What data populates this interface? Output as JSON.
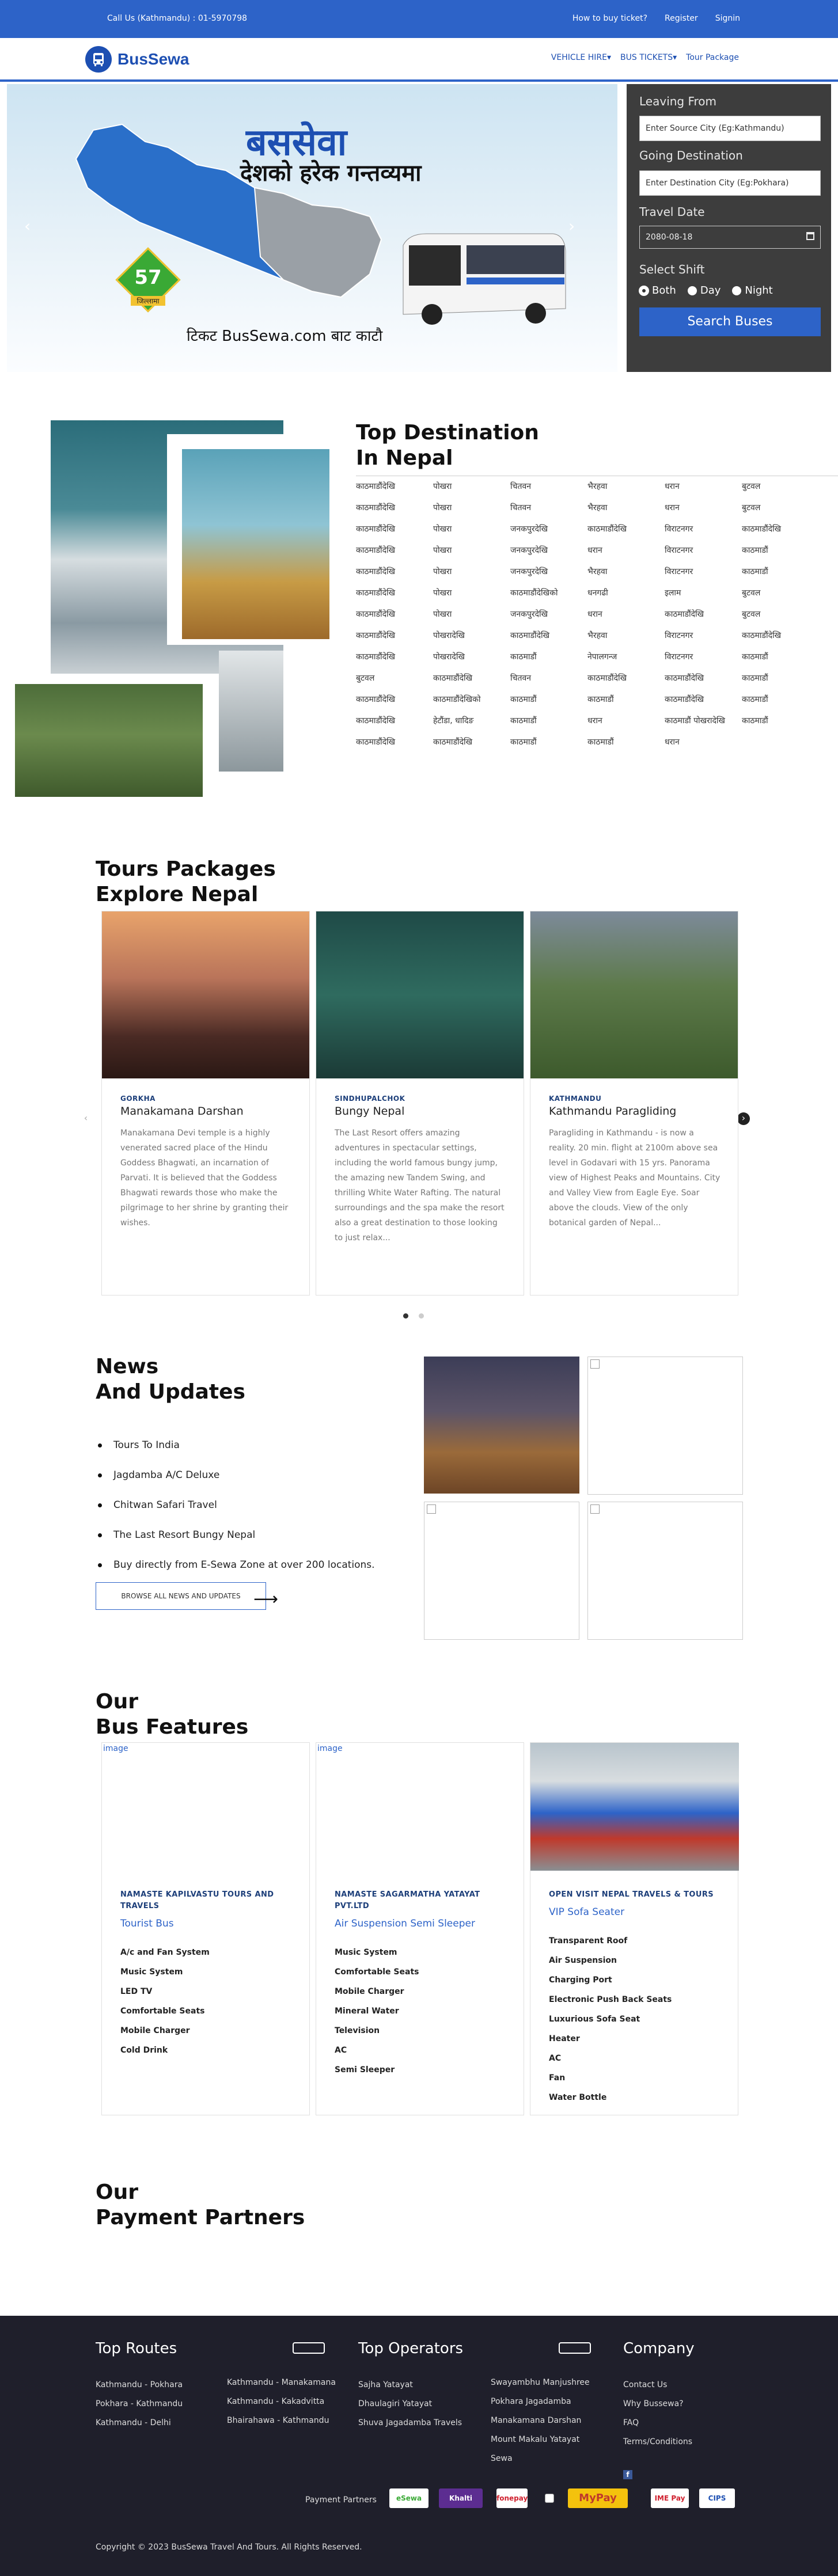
{
  "topbar": {
    "call": "Call Us (Kathmandu) : 01-5970798",
    "links": [
      "How to buy ticket?",
      "Register",
      "Signin"
    ]
  },
  "nav": {
    "logo": "BusSewa",
    "items": [
      "VEHICLE HIRE▾",
      "BUS TICKETS▾",
      "Tour Package"
    ]
  },
  "hero": {
    "title": "बससेवा",
    "subtitle": "देशको हरेक गन्तव्यमा",
    "tagline": "टिकट BusSewa.com बाट काटौ",
    "badge_number": "57",
    "badge_label": "जिल्लामा"
  },
  "search": {
    "from_label": "Leaving From",
    "from_placeholder": "Enter Source City (Eg:Kathmandu)",
    "to_label": "Going Destination",
    "to_placeholder": "Enter Destination City (Eg:Pokhara)",
    "date_label": "Travel Date",
    "date_value": "2080-08-18",
    "shift_label": "Select Shift",
    "shifts": [
      "Both",
      "Day",
      "Night"
    ],
    "button": "Search Buses"
  },
  "destinations": {
    "title1": "Top Destination",
    "title2": "In Nepal",
    "rows": [
      [
        "काठमाडौंदेखि",
        "पोखरा",
        "चितवन",
        "भैरहवा",
        "धरान",
        "बुटवल"
      ],
      [
        "काठमाडौंदेखि",
        "पोखरा",
        "चितवन",
        "भैरहवा",
        "धरान",
        "बुटवल"
      ],
      [
        "काठमाडौंदेखि",
        "पोखरा",
        "जनकपुरदेखि",
        "काठमाडौंदेखि",
        "विराटनगर",
        "काठमाडौंदेखि"
      ],
      [
        "काठमाडौंदेखि",
        "पोखरा",
        "जनकपुरदेखि",
        "धरान",
        "विराटनगर",
        "काठमाडौं"
      ],
      [
        "काठमाडौंदेखि",
        "पोखरा",
        "जनकपुरदेखि",
        "भैरहवा",
        "विराटनगर",
        "काठमाडौं"
      ],
      [
        "काठमाडौंदेखि",
        "पोखरा",
        "काठमाडौंदेखिको",
        "धनगढी",
        "इलाम",
        "बुटवल"
      ],
      [
        "काठमाडौंदेखि",
        "पोखरा",
        "जनकपुरदेखि",
        "धरान",
        "काठमाडौंदेखि",
        "बुटवल"
      ],
      [
        "काठमाडौंदेखि",
        "पोखरादेखि",
        "काठमाडौंदेखि",
        "भैरहवा",
        "विराटनगर",
        "काठमाडौंदेखि"
      ],
      [
        "काठमाडौंदेखि",
        "पोखरादेखि",
        "काठमाडौं",
        "नेपालगन्ज",
        "विराटनगर",
        "काठमाडौं"
      ],
      [
        "बुटवल",
        "काठमाडौंदेखि",
        "चितवन",
        "काठमाडौंदेखि",
        "काठमाडौंदेखि",
        "काठमाडौं"
      ],
      [
        "काठमाडौंदेखि",
        "काठमाडौंदेखिको",
        "काठमाडौं",
        "काठमाडौं",
        "काठमाडौंदेखि",
        "काठमाडौं"
      ],
      [
        "काठमाडौंदेखि",
        "हेटौंडा, धादिङ",
        "काठमाडौं",
        "धरान",
        "काठमाडौं पोखरादेखि",
        "काठमाडौं"
      ],
      [
        "काठमाडौंदेखि",
        "काठमाडौंदेखि",
        "काठमाडौं",
        "काठमाडौं",
        "धरान",
        ""
      ]
    ]
  },
  "tours": {
    "title1": "Tours Packages",
    "title2": "Explore Nepal",
    "items": [
      {
        "location": "GORKHA",
        "name": "Manakamana Darshan",
        "desc": "Manakamana Devi temple is a highly venerated sacred place of the Hindu Goddess Bhagwati, an incarnation of Parvati.   It is believed that the Goddess Bhagwati rewards those who make the pilgrimage to her shrine by granting their wishes."
      },
      {
        "location": "SINDHUPALCHOK",
        "name": "Bungy Nepal",
        "desc": "The Last Resort offers amazing adventures in spectacular settings, including the world famous bungy jump, the amazing new Tandem Swing, and thrilling White Water Rafting. The natural surroundings and the spa make the resort also a great destination to those looking to just relax..."
      },
      {
        "location": "KATHMANDU",
        "name": "Kathmandu Paragliding",
        "desc": "Paragliding in Kathmandu - is now a reality. 20 min. flight at 2100m above sea level in Godavari with 15 yrs. Panorama view of Highest Peaks and Mountains. City and Valley View from Eagle Eye. Soar above the clouds. View of the only botanical garden of Nepal..."
      }
    ],
    "prev": "‹",
    "next": "›"
  },
  "news": {
    "title1": "News",
    "title2": "And Updates",
    "items": [
      "Tours To India",
      "Jagdamba A/C Deluxe",
      "Chitwan Safari Travel",
      "The Last Resort Bungy Nepal",
      "Buy directly from E-Sewa Zone at over 200 locations."
    ],
    "browse": "BROWSE ALL NEWS AND UPDATES"
  },
  "features": {
    "title1": "Our",
    "title2": "Bus Features",
    "cards": [
      {
        "img_alt": "image",
        "operator": "NAMASTE KAPILVASTU TOURS AND TRAVELS",
        "type": "Tourist Bus",
        "features": [
          "A/c and Fan System",
          "Music System",
          "LED TV",
          "Comfortable Seats",
          "Mobile Charger",
          "Cold Drink"
        ]
      },
      {
        "img_alt": "image",
        "operator": "NAMASTE SAGARMATHA YATAYAT PVT.LTD",
        "type": "Air Suspension Semi Sleeper",
        "features": [
          "Music System",
          "Comfortable Seats",
          "Mobile Charger",
          "Mineral Water",
          "Television",
          "AC",
          "Semi Sleeper"
        ]
      },
      {
        "img_alt": "",
        "operator": "OPEN VISIT NEPAL TRAVELS & TOURS",
        "type": "VIP Sofa Seater",
        "features": [
          "Transparent Roof",
          "Air Suspension",
          "Charging Port",
          "Electronic Push Back Seats",
          "Luxurious Sofa Seat",
          "Heater",
          "AC",
          "Fan",
          "Water Bottle"
        ]
      }
    ]
  },
  "partners": {
    "title1": "Our",
    "title2": "Payment Partners"
  },
  "footer": {
    "routes_title": "Top Routes",
    "routes_a": [
      "Kathmandu - Pokhara",
      "Pokhara - Kathmandu",
      "Kathmandu - Delhi"
    ],
    "routes_b": [
      "Kathmandu - Manakamana",
      "Kathmandu - Kakadvitta",
      "Bhairahawa - Kathmandu"
    ],
    "operators_title": "Top Operators",
    "operators_a": [
      "Sajha Yatayat",
      "Dhaulagiri Yatayat",
      "Shuva Jagadamba Travels"
    ],
    "operators_b": [
      "Swayambhu Manjushree",
      "Pokhara Jagadamba",
      "Manakamana Darshan",
      "Mount Makalu Yatayat",
      "Sewa"
    ],
    "company_title": "Company",
    "company": [
      "Contact Us",
      "Why Bussewa?",
      "FAQ",
      "Terms/Conditions"
    ],
    "payment_label": "Payment Partners",
    "payment_logos": [
      "eSewa",
      "Khalti",
      "fonepay",
      "MyPay",
      "IME Pay",
      "CIPS",
      "Prabhu"
    ],
    "copyright": "Copyright © 2023 BusSewa Travel And Tours. All Rights Reserved."
  },
  "colors": {
    "primary": "#2d63c8",
    "navy": "#1d4fb2",
    "footer": "#1f1f2b",
    "panel": "#3d3d3d"
  }
}
